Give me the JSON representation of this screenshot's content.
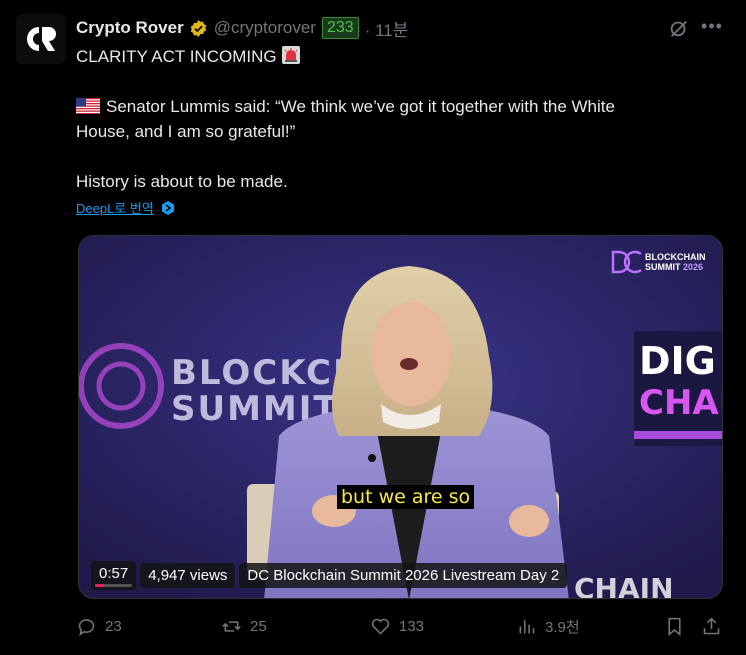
{
  "tweet": {
    "author_name": "Crypto Rover",
    "handle": "@cryptorover",
    "badge": "233",
    "time": "· 11분",
    "line1": "CLARITY ACT INCOMING",
    "line2": "Senator Lummis said: “We think we’ve got it together with the White",
    "line3": "House, and I am so grateful!”",
    "line4": "History is about to be made.",
    "translate_label": "DeepL로 번역"
  },
  "video": {
    "subtitle": "but we are so",
    "duration": "0:57",
    "progress": 0.25,
    "views": "4,947 views",
    "title": "DC Blockchain Summit 2026 Livestream Day 2",
    "brand_line1": "BLOCKCHAIN",
    "brand_line2": "SUMMIT",
    "brand_year": "2026",
    "stage_text1": "BLOCKCHA",
    "stage_text2": "SUMMIT",
    "stage_right1": "DIG",
    "stage_right2": "CHAI",
    "stage_bottom": "CHAIN"
  },
  "actions": {
    "replies": "23",
    "reposts": "25",
    "likes": "133",
    "views": "3.9천"
  },
  "colors": {
    "accent": "#1d9bf0",
    "muted": "#71767b",
    "subtitle_yellow": "#f7e84a",
    "badge_green": "#4cc24c",
    "progress": "#e0245e"
  },
  "icons": [
    "avatar-logo",
    "verified-badge-icon",
    "grok-icon",
    "more-icon",
    "us-flag-icon",
    "siren-icon",
    "deepl-icon",
    "reply-icon",
    "repost-icon",
    "like-icon",
    "views-icon",
    "bookmark-icon",
    "share-icon"
  ]
}
